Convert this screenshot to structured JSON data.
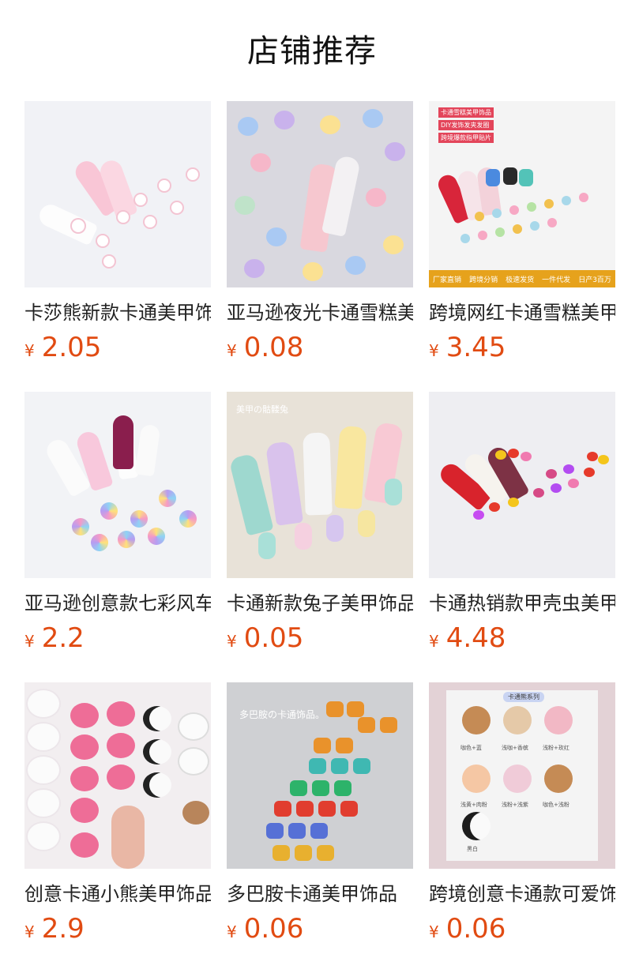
{
  "page": {
    "title": "店铺推荐"
  },
  "currency_symbol": "¥",
  "products": [
    {
      "title": "卡莎熊新款卡通美甲饰品",
      "price": "2.05",
      "image_icon": "bunny-nail-charms-image",
      "overlay": {}
    },
    {
      "title": "亚马逊夜光卡通雪糕美甲饰品",
      "price": "0.08",
      "image_icon": "glow-cartoon-charms-image",
      "overlay": {}
    },
    {
      "title": "跨境网红卡通雪糕美甲饰品",
      "price": "3.45",
      "image_icon": "icecream-nail-charms-image",
      "overlay": {
        "top": [
          "卡通雪糕美甲饰品",
          "DIY发饰发夹发圈",
          "跨境爆款指甲贴片"
        ],
        "strip": [
          "厂家直销",
          "跨境分销",
          "极速发货",
          "一件代发",
          "日产3百万"
        ]
      }
    },
    {
      "title": "亚马逊创意款七彩风车美甲饰品",
      "price": "2.2",
      "image_icon": "windmill-nail-charms-image",
      "overlay": {}
    },
    {
      "title": "卡通新款兔子美甲饰品",
      "price": "0.05",
      "image_icon": "rabbit-nail-charms-image",
      "overlay": {
        "top": [
          "美甲の骷髅兔"
        ]
      }
    },
    {
      "title": "卡通热销款甲壳虫美甲饰品",
      "price": "4.48",
      "image_icon": "ladybug-nail-charms-image",
      "overlay": {}
    },
    {
      "title": "创意卡通小熊美甲饰品",
      "price": "2.9",
      "image_icon": "bear-nail-charms-image",
      "overlay": {}
    },
    {
      "title": "多巴胺卡通美甲饰品",
      "price": "0.06",
      "image_icon": "dopamine-cartoon-charms-image",
      "overlay": {
        "top": [
          "多巴胺の卡通饰品。"
        ]
      }
    },
    {
      "title": "跨境创意卡通款可爱饰品",
      "price": "0.06",
      "image_icon": "bear-series-charms-image",
      "overlay": {
        "top": [
          "卡通熊系列"
        ],
        "labels": [
          "咖色+蓝",
          "浅咖+香槟",
          "浅粉+玫红",
          "浅黄+肉粉",
          "浅粉+浅紫",
          "咖色+浅粉",
          "黑白"
        ]
      }
    }
  ]
}
